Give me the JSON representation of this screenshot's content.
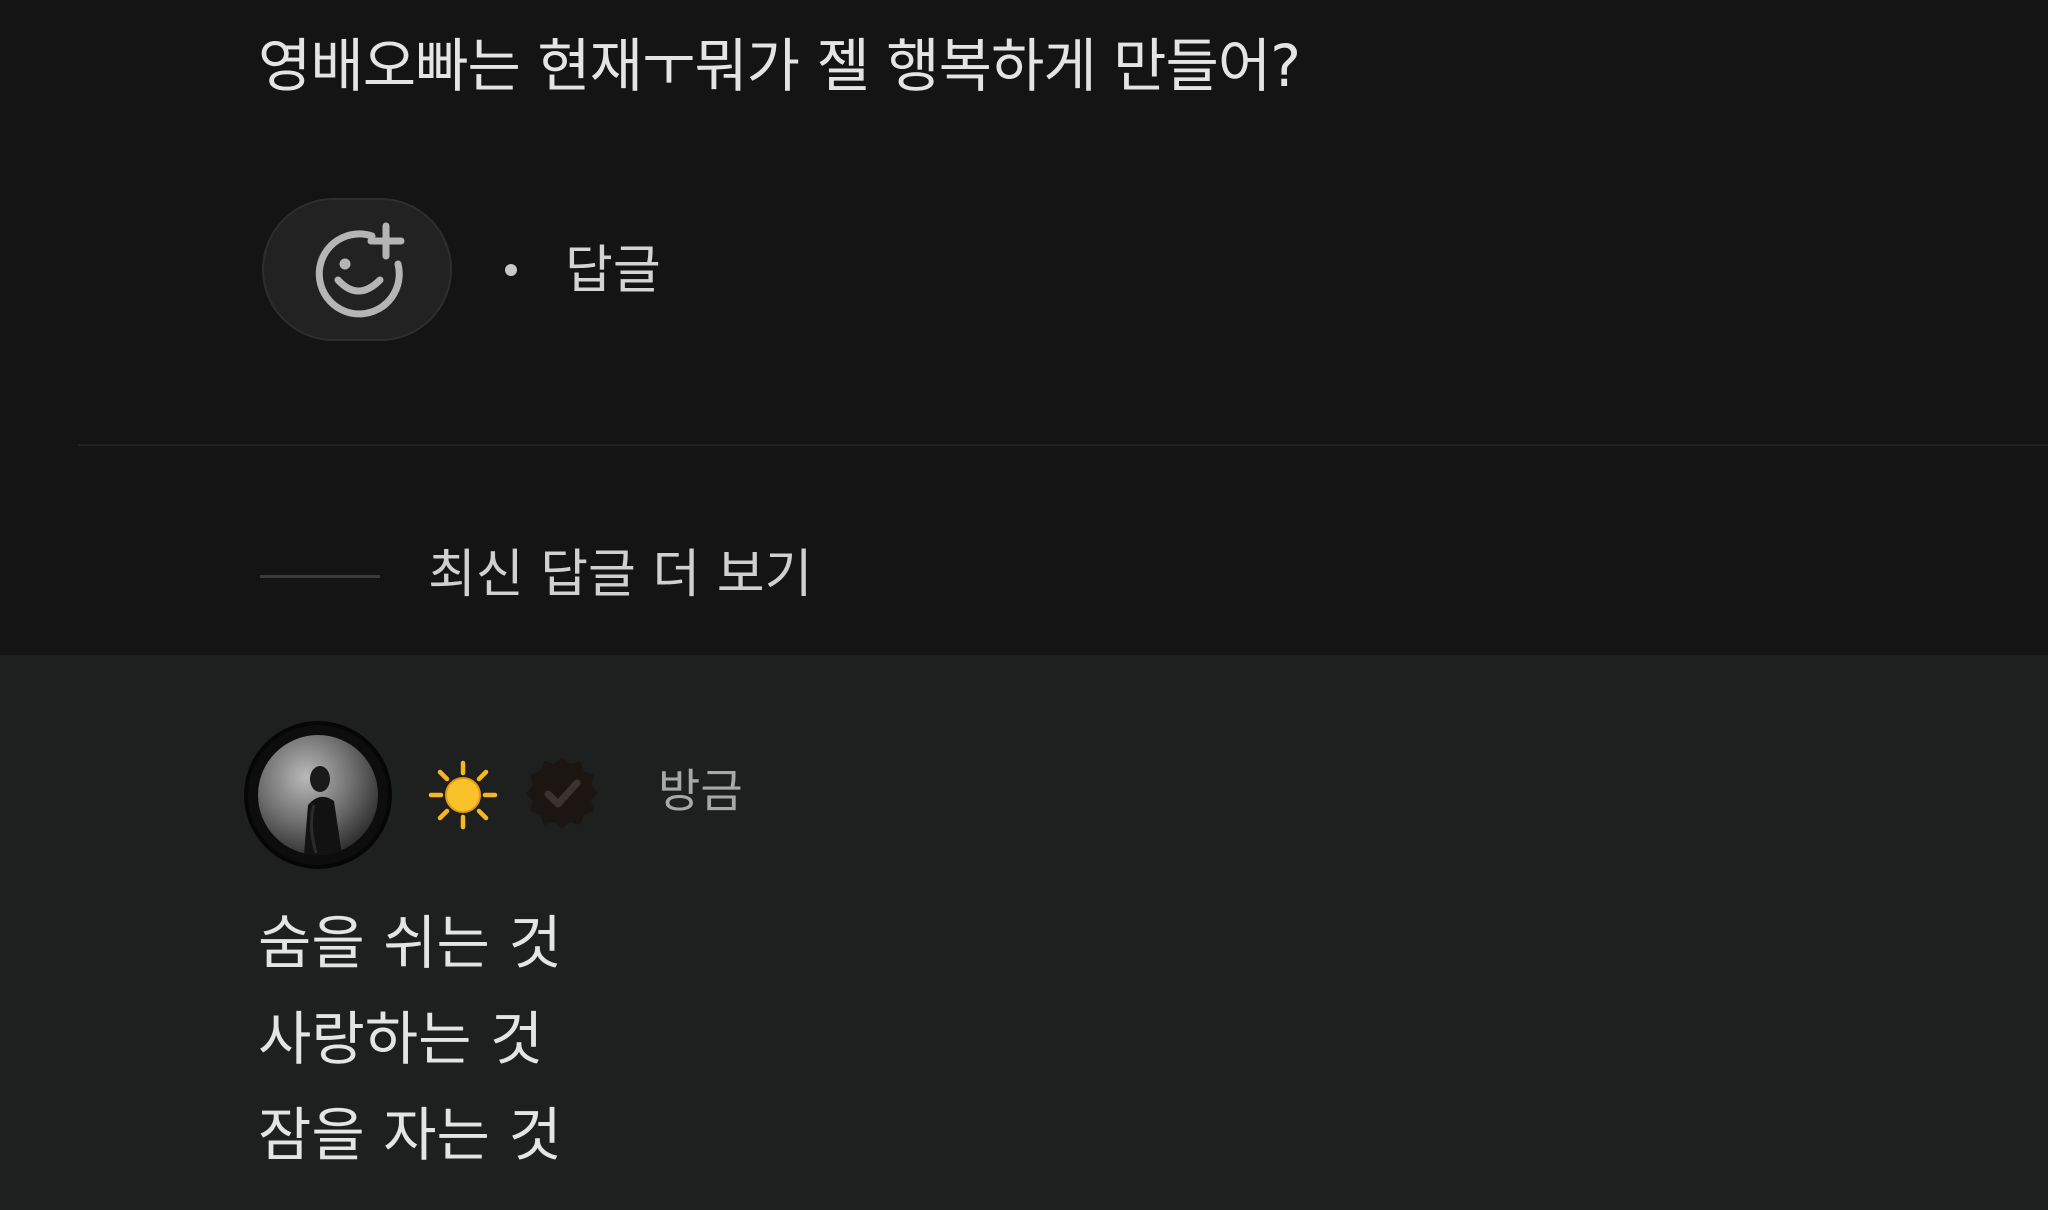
{
  "comment": {
    "text": "영배오빠는 현재ㅜ뭐가 젤 행복하게 만들어?",
    "reply_label": "답글"
  },
  "thread": {
    "more_replies_label": "최신 답글 더 보기"
  },
  "reply": {
    "timestamp": "방금",
    "badge_emoji": "☀️",
    "lines": [
      "숨을 쉬는 것",
      "사랑하는 것",
      "잠을 자는 것"
    ]
  },
  "icons": {
    "reaction": "add-reaction-icon",
    "badge": "sun-icon",
    "verified": "verified-badge-icon"
  },
  "colors": {
    "background": "#141414",
    "reply_background": "#1e1f1f",
    "sun": "#f7b81f",
    "verified": "#1c1612"
  }
}
